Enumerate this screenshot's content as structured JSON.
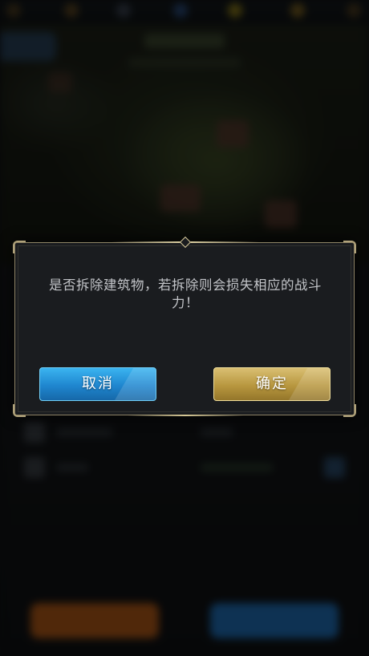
{
  "dialog": {
    "message": "是否拆除建筑物，若拆除则会损失相应的战斗力！",
    "cancel_label": "取消",
    "confirm_label": "确定"
  },
  "colors": {
    "dialog_bg": "#1a1c1f",
    "dialog_border": "#8f8466",
    "cancel_button": "#1f86cf",
    "confirm_button": "#b8973f",
    "message_text": "#c2c4c8"
  }
}
